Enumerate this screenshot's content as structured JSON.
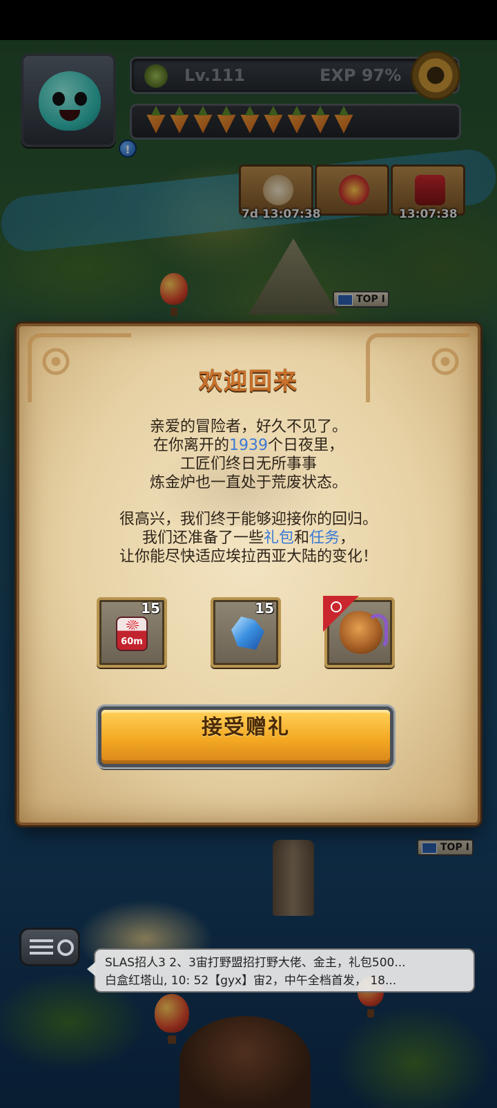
{
  "hud": {
    "level": "Lv.111",
    "exp": "EXP 97%",
    "carrot_count": 9
  },
  "events": [
    {
      "name": "daily-event",
      "timer": "7d 13:07:38"
    },
    {
      "name": "reward-event",
      "timer": ""
    },
    {
      "name": "chest-event",
      "timer": "13:07:38"
    }
  ],
  "map_tags": {
    "top_rank_1": "TOP I",
    "top_rank_2": "TOP I"
  },
  "dialog": {
    "title": "欢迎回来",
    "p1_line1": "亲爱的冒险者，好久不见了。",
    "p1_line2_pre": "在你离开的",
    "p1_line2_days": "1939",
    "p1_line2_post": "个日夜里，",
    "p1_line3": "工匠们终日无所事事",
    "p1_line4": "炼金炉也一直处于荒废状态。",
    "p2_line1": "很高兴，我们终于能够迎接你的回归。",
    "p2_line2_pre": "我们还准备了一些",
    "p2_line2_gift": "礼包",
    "p2_line2_mid": "和",
    "p2_line2_task": "任务",
    "p2_line2_post": "，",
    "p2_line3": "让你能尽快适应埃拉西亚大陆的变化！",
    "rewards": [
      {
        "name": "speedup-60m",
        "icon_label": "60m",
        "count": "15"
      },
      {
        "name": "blue-crystal",
        "count": "15"
      },
      {
        "name": "pet",
        "count": ""
      }
    ],
    "accept_label": "接受赠礼"
  },
  "chat": {
    "line1": "SLAS招人3 2、3宙打野盟招打野大佬、金主，礼包500...",
    "line2": "白盒红塔山, 10: 52【gyx】宙2，中午全档首发， 18..."
  },
  "colors": {
    "title": "#c9702a",
    "highlight": "#3a7ad6",
    "button": "#f4a923",
    "parchment": "#e6d1a4"
  }
}
